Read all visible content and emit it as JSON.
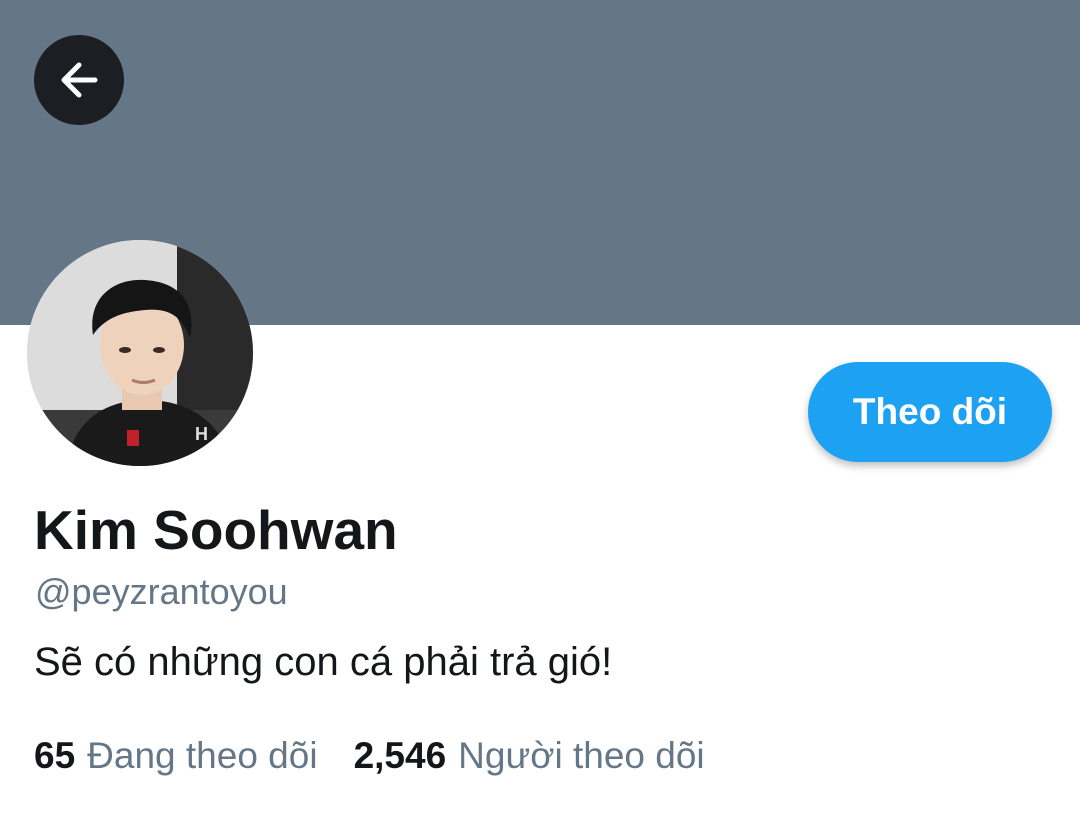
{
  "header": {
    "back_icon": "arrow-left-icon",
    "banner_color": "#657786"
  },
  "profile": {
    "display_name": "Kim Soohwan",
    "handle": "@peyzrantoyou",
    "bio": "Sẽ có những con cá phải trả gió!",
    "follow_label": "Theo dõi",
    "accent_color": "#1da1f2"
  },
  "stats": {
    "following_count": "65",
    "following_label": "Đang theo dõi",
    "followers_count": "2,546",
    "followers_label": "Người theo dõi"
  }
}
